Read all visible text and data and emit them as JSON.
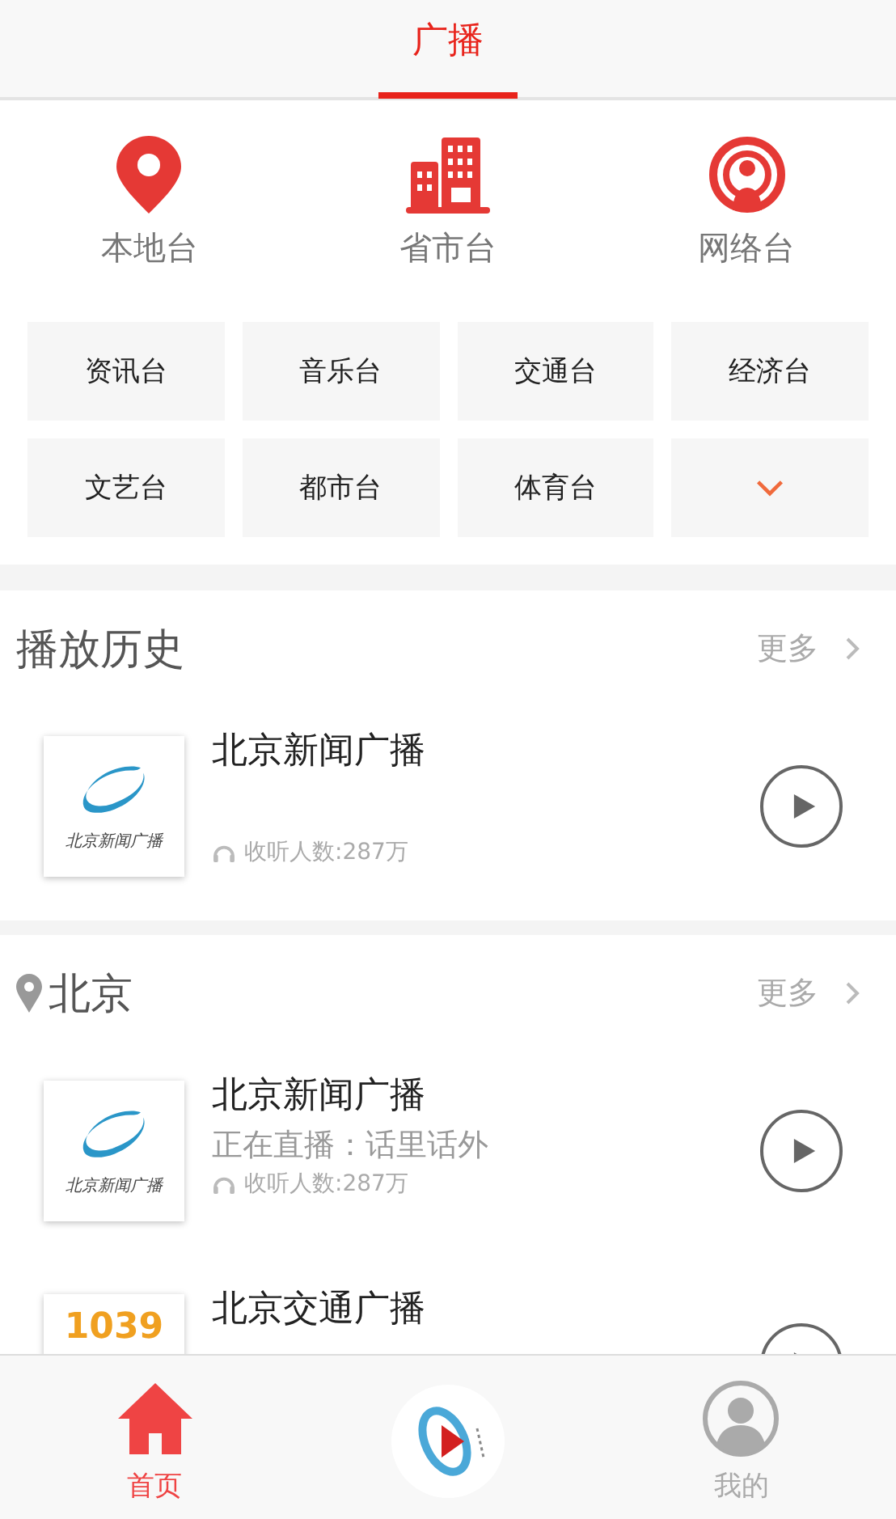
{
  "top_tabs": [
    {
      "label": "广播",
      "selected": true
    }
  ],
  "categories": [
    {
      "label": "本地台",
      "kind": "pin"
    },
    {
      "label": "省市台",
      "kind": "building"
    },
    {
      "label": "网络台",
      "kind": "broadcast"
    }
  ],
  "genres": [
    {
      "label": "资讯台",
      "kind": "text"
    },
    {
      "label": "音乐台",
      "kind": "text"
    },
    {
      "label": "交通台",
      "kind": "text"
    },
    {
      "label": "经济台",
      "kind": "text"
    },
    {
      "label": "文艺台",
      "kind": "text"
    },
    {
      "label": "都市台",
      "kind": "text"
    },
    {
      "label": "体育台",
      "kind": "text"
    },
    {
      "kind": "expand"
    }
  ],
  "sections": [
    {
      "title": "播放历史",
      "location": false,
      "more": "更多",
      "items": [
        {
          "kind": "swirl",
          "logo_text": "北京新闻广播",
          "title": "北京新闻广播",
          "listeners": "收听人数:287万"
        }
      ]
    },
    {
      "title": "北京",
      "location": true,
      "more": "更多",
      "items": [
        {
          "kind": "swirl",
          "logo_text": "北京新闻广播",
          "title": "北京新闻广播",
          "live": "正在直播：话里话外",
          "listeners": "收听人数:287万"
        },
        {
          "kind": "number",
          "logo_text": "1039",
          "title": "北京交通广播"
        }
      ]
    }
  ],
  "bottom_nav": [
    {
      "label": "首页",
      "kind": "home",
      "selected": true
    },
    {
      "kind": "player"
    },
    {
      "label": "我的",
      "kind": "profile",
      "selected": false
    }
  ]
}
